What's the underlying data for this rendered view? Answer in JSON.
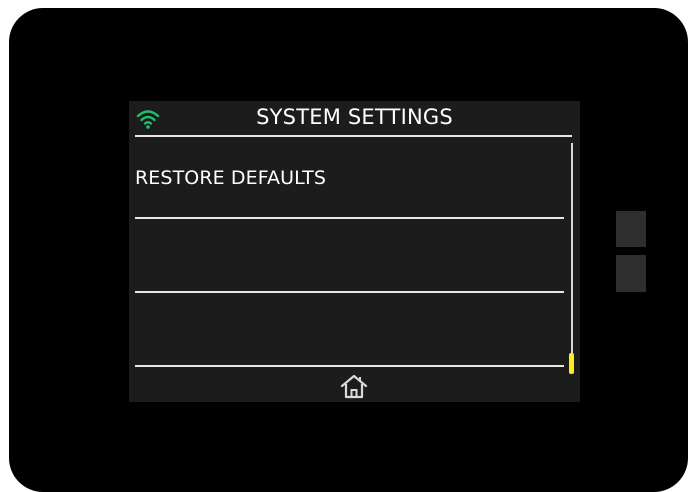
{
  "screen": {
    "title": "SYSTEM SETTINGS",
    "icons": {
      "status": "wifi-icon",
      "nav": "home-icon"
    },
    "items": [
      {
        "label": "RESTORE DEFAULTS"
      },
      {
        "label": ""
      },
      {
        "label": ""
      }
    ],
    "scroll_position": 1.0
  },
  "colors": {
    "device_body": "#000000",
    "screen_bg": "#1c1c1c",
    "text": "#ffffff",
    "wifi_accent": "#1fbf6a",
    "scroll_thumb": "#ffeb1a"
  }
}
